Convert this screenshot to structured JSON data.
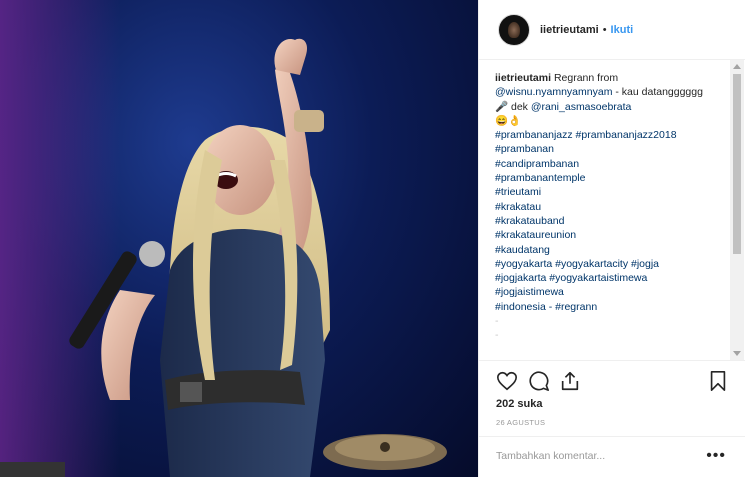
{
  "post": {
    "username": "iietrieutami",
    "separator": "•",
    "follow_label": "Ikuti",
    "caption": {
      "author": "iietrieutami",
      "text_1": "Regrann from",
      "mention_1": "@wisnu.nyamnyamnyam",
      "text_2": "- kau datangggggg 🎤 dek",
      "mention_2": "@rani_asmasoebrata",
      "emoji": "😄👌",
      "hashtags": [
        "#prambananjazz #prambananjazz2018",
        "#prambanan",
        "#candiprambanan",
        "#prambanantemple",
        "#trieutami",
        "#krakatau",
        "#krakatauband",
        "#krakataureunion",
        "#kaudatang",
        "#yogyakarta #yogyakartacity #jogja",
        "#jogjakarta #yogyakartaistimewa",
        "#jogjaistimewa",
        "#indonesia - #regrann"
      ],
      "trailing_1": "-",
      "trailing_2": "-"
    },
    "likes_text": "202 suka",
    "date_text": "26 AGUSTUS",
    "comment_placeholder": "Tambahkan komentar...",
    "more_label": "•••",
    "icons": [
      "heart-icon",
      "comment-icon",
      "share-icon",
      "bookmark-icon"
    ]
  }
}
